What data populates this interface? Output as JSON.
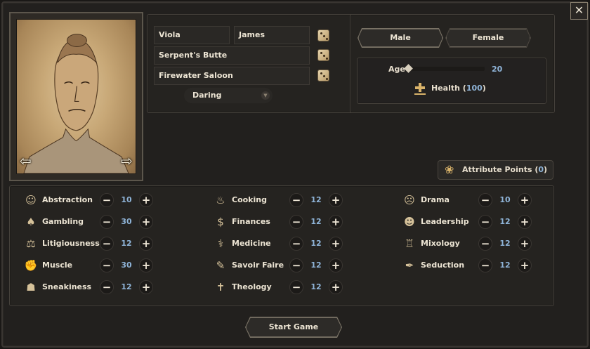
{
  "close_label": "✕",
  "character": {
    "first_name": "Viola",
    "last_name": "James",
    "hometown": "Serpent's Butte",
    "saloon": "Firewater Saloon",
    "trait": "Daring"
  },
  "gender": {
    "male_label": "Male",
    "female_label": "Female",
    "selected": "Male"
  },
  "age": {
    "label": "Age",
    "value": "20",
    "slider_fraction": 0.0
  },
  "health": {
    "label": "Health",
    "open": "(",
    "value": "100",
    "close": ")"
  },
  "attribute_points": {
    "label": "Attribute Points",
    "open": "(",
    "value": "0",
    "close": ")"
  },
  "skills": [
    {
      "name": "Abstraction",
      "value": "10",
      "icon": "head-icon"
    },
    {
      "name": "Gambling",
      "value": "30",
      "icon": "cards-icon"
    },
    {
      "name": "Litigiousness",
      "value": "12",
      "icon": "scales-icon"
    },
    {
      "name": "Muscle",
      "value": "30",
      "icon": "arm-icon"
    },
    {
      "name": "Sneakiness",
      "value": "12",
      "icon": "sneak-icon"
    },
    {
      "name": "Cooking",
      "value": "12",
      "icon": "stove-icon"
    },
    {
      "name": "Finances",
      "value": "12",
      "icon": "dollar-icon"
    },
    {
      "name": "Medicine",
      "value": "12",
      "icon": "medicine-icon"
    },
    {
      "name": "Savoir Faire",
      "value": "12",
      "icon": "palette-icon"
    },
    {
      "name": "Theology",
      "value": "12",
      "icon": "cross-icon"
    },
    {
      "name": "Drama",
      "value": "10",
      "icon": "mask-icon"
    },
    {
      "name": "Leadership",
      "value": "12",
      "icon": "group-icon"
    },
    {
      "name": "Mixology",
      "value": "12",
      "icon": "bartender-icon"
    },
    {
      "name": "Seduction",
      "value": "12",
      "icon": "quill-icon"
    }
  ],
  "start_label": "Start Game",
  "colors": {
    "accent_gold": "#d9b36a",
    "value_blue": "#8fb4d8",
    "panel_bg": "#252320"
  }
}
